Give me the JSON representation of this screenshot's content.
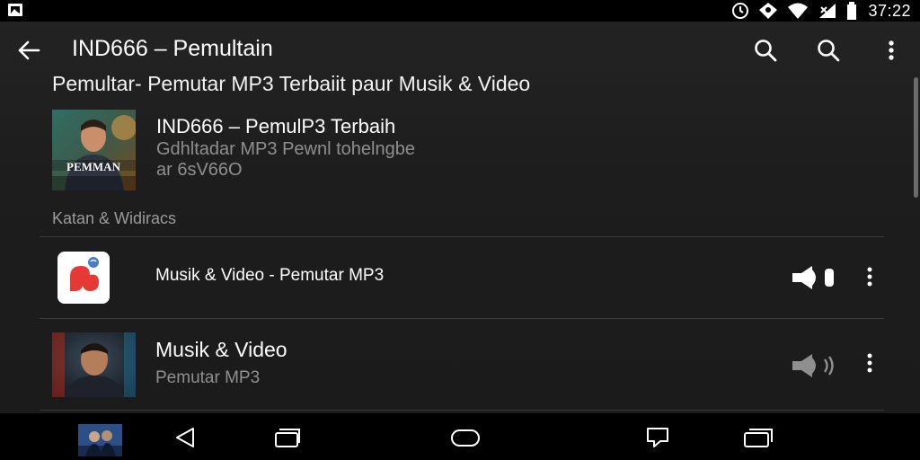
{
  "status_bar": {
    "time": "37:22",
    "icons": [
      "gallery-icon",
      "alarm-icon",
      "location-icon",
      "wifi-icon",
      "signal-icon",
      "battery-icon"
    ]
  },
  "app_bar": {
    "title": "IND666 – Pemultain",
    "icons": [
      "back-arrow-icon",
      "search-icon",
      "search-icon",
      "more-vert-icon"
    ]
  },
  "subtitle": "Pemultar- Pemutar MP3 Terbaiit paur Musik & Video",
  "featured": {
    "title": "IND666 – PemulP3 Terbaih",
    "line2": "Gdhltadar MP3 Pewnl tohelngbe",
    "line3": "ar 6sV66O",
    "thumb_text": "PEMMAN"
  },
  "section_label": "Katan & Widiracs",
  "rows": [
    {
      "title": "Musik & Video - Pemutar MP3",
      "subtitle": "",
      "icon": "app-logo-icon",
      "action_icon": "play-icon",
      "menu_icon": "more-vert-icon"
    },
    {
      "title": "Musik & Video",
      "subtitle": "Pemutar MP3",
      "icon": "artist-thumbnail",
      "action_icon": "speaker-icon",
      "menu_icon": "more-vert-icon"
    }
  ],
  "nav_bar": {
    "icons": [
      "recent-thumbnail",
      "back-triangle-icon",
      "recents-icon",
      "home-icon",
      "message-icon",
      "windows-icon"
    ]
  },
  "colors": {
    "background": "#1e1e1e",
    "bar": "#000000",
    "primary_text": "#ffffff",
    "secondary_text": "#8f8f8f",
    "divider": "#3a3a3a",
    "accent_red": "#e53935"
  }
}
